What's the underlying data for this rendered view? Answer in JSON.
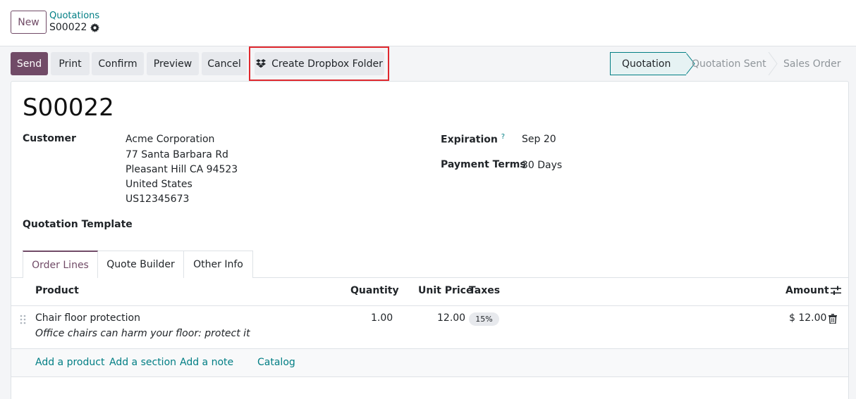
{
  "header": {
    "new_label": "New",
    "breadcrumb": "Quotations",
    "record": "S00022"
  },
  "actions": {
    "send": "Send",
    "print": "Print",
    "confirm": "Confirm",
    "preview": "Preview",
    "cancel": "Cancel",
    "dropbox": "Create Dropbox Folder"
  },
  "status": {
    "stages": [
      "Quotation",
      "Quotation Sent",
      "Sales Order"
    ],
    "current": "Quotation"
  },
  "form": {
    "title": "S00022",
    "customer_label": "Customer",
    "customer_lines": [
      "Acme Corporation",
      "77 Santa Barbara Rd",
      "Pleasant Hill CA 94523",
      "United States",
      "US12345673"
    ],
    "expiration_label": "Expiration",
    "expiration_help": "?",
    "expiration_value": "Sep 20",
    "payment_terms_label": "Payment Terms",
    "payment_terms_value": "30 Days",
    "template_label": "Quotation Template"
  },
  "tabs": [
    "Order Lines",
    "Quote Builder",
    "Other Info"
  ],
  "table": {
    "headers": {
      "product": "Product",
      "quantity": "Quantity",
      "unit_price": "Unit Price",
      "taxes": "Taxes",
      "amount": "Amount"
    },
    "rows": [
      {
        "product": "Chair floor protection",
        "description": "Office chairs can harm your floor: protect it",
        "quantity": "1.00",
        "unit_price": "12.00",
        "tax": "15%",
        "amount": "$ 12.00"
      }
    ],
    "links": {
      "add_product": "Add a product",
      "add_section": "Add a section",
      "add_note": "Add a note",
      "catalog": "Catalog"
    }
  },
  "colors": {
    "primary": "#714b67",
    "teal": "#017e84",
    "highlight": "#e0282e"
  },
  "icons": [
    "gear-icon",
    "dropbox-icon",
    "drag-handle-icon",
    "trash-icon",
    "sliders-icon"
  ]
}
